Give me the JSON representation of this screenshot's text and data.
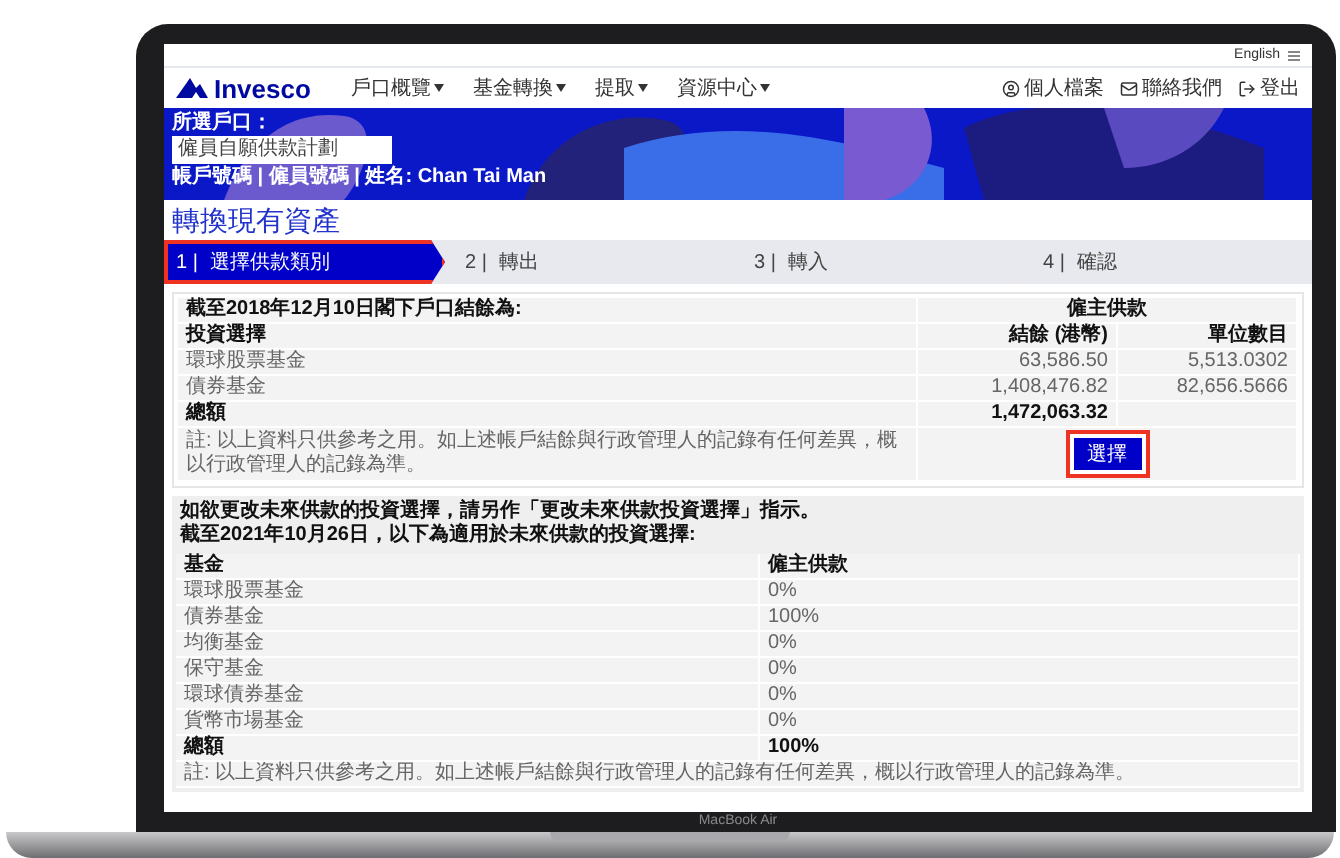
{
  "device_label": "MacBook Air",
  "top_bar": {
    "language": "English"
  },
  "nav": {
    "brand": "Invesco",
    "menu": [
      "戶口概覽",
      "基金轉換",
      "提取",
      "資源中心"
    ],
    "actions": [
      {
        "kind": "profile",
        "label": "個人檔案"
      },
      {
        "kind": "contact",
        "label": "聯絡我們"
      },
      {
        "kind": "logout",
        "label": "登出"
      }
    ]
  },
  "banner": {
    "account_label": "所選戶口：",
    "account_value": "僱員自願供款計劃",
    "info": "帳戶號碼 | 僱員號碼 | 姓名: Chan Tai Man"
  },
  "page_title": "轉換現有資產",
  "steps": [
    {
      "number": "1 |",
      "label": "選擇供款類別",
      "selected": true,
      "highlighted": true
    },
    {
      "number": "2 |",
      "label": "轉出",
      "selected": false,
      "highlighted": false
    },
    {
      "number": "3 |",
      "label": "轉入",
      "selected": false,
      "highlighted": false
    },
    {
      "number": "4 |",
      "label": "確認",
      "selected": false,
      "highlighted": false
    }
  ],
  "balance_table": {
    "caption": "截至2018年12月10日閣下戶口結餘為:",
    "group_header": "僱主供款",
    "columns": [
      "投資選擇",
      "結餘 (港幣)",
      "單位數目"
    ],
    "rows": [
      [
        "環球股票基金",
        "63,586.50",
        "5,513.0302"
      ],
      [
        "債券基金",
        "1,408,476.82",
        "82,656.5666"
      ]
    ],
    "total": {
      "label": "總額",
      "balance": "1,472,063.32"
    },
    "note": "註: 以上資料只供參考之用。如上述帳戶結餘與行政管理人的記錄有任何差異，概以行政管理人的記錄為準。",
    "button": {
      "label": "選擇",
      "highlighted": true
    }
  },
  "future_section": {
    "lines": [
      "如欲更改未來供款的投資選擇，請另作「更改未來供款投資選擇」指示。",
      "截至2021年10月26日，以下為適用於未來供款的投資選擇:"
    ],
    "columns": [
      "基金",
      "僱主供款"
    ],
    "rows": [
      [
        "環球股票基金",
        "0%"
      ],
      [
        "債券基金",
        "100%"
      ],
      [
        "均衡基金",
        "0%"
      ],
      [
        "保守基金",
        "0%"
      ],
      [
        "環球債券基金",
        "0%"
      ],
      [
        "貨幣市場基金",
        "0%"
      ]
    ],
    "total": {
      "label": "總額",
      "value": "100%"
    },
    "note": "註: 以上資料只供參考之用。如上述帳戶結餘與行政管理人的記錄有任何差異，概以行政管理人的記錄為準。"
  }
}
